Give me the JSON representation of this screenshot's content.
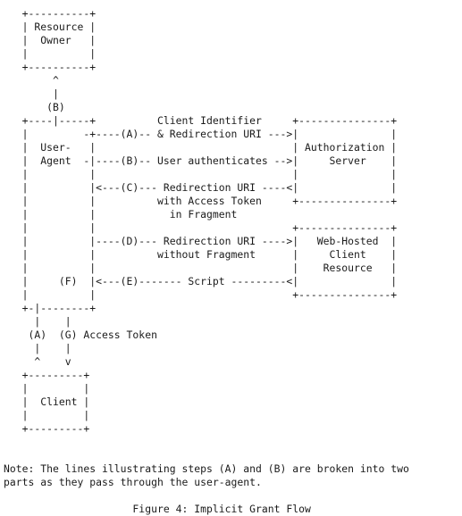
{
  "figure": {
    "lines": [
      "   +----------+",
      "   | Resource |",
      "   |  Owner   |",
      "   |          |",
      "   +----------+",
      "        ^",
      "        |",
      "       (B)",
      "   +----|-----+          Client Identifier     +---------------+",
      "   |         -+----(A)-- & Redirection URI --->|               |",
      "   |  User-   |                                | Authorization |",
      "   |  Agent  -|----(B)-- User authenticates -->|     Server    |",
      "   |          |                                |               |",
      "   |          |<---(C)--- Redirection URI ----<|               |",
      "   |          |          with Access Token     +---------------+",
      "   |          |            in Fragment",
      "   |          |                                +---------------+",
      "   |          |----(D)--- Redirection URI ---->|   Web-Hosted  |",
      "   |          |          without Fragment      |     Client    |",
      "   |          |                                |    Resource   |",
      "   |     (F)  |<---(E)------- Script ---------<|               |",
      "   |          |                                +---------------+",
      "   +-|--------+",
      "     |    |",
      "    (A)  (G) Access Token",
      "     |    |",
      "     ^    v",
      "   +---------+",
      "   |         |",
      "   |  Client |",
      "   |         |",
      "   +---------+",
      "",
      "",
      "Note: The lines illustrating steps (A) and (B) are broken into two",
      "parts as they pass through the user-agent.",
      "",
      "                     Figure 4: Implicit Grant Flow"
    ],
    "entities": {
      "resource_owner": "Resource Owner",
      "user_agent": "User-Agent",
      "authorization_server": "Authorization Server",
      "web_hosted_client_resource": "Web-Hosted Client Resource",
      "client": "Client"
    },
    "steps": {
      "A": "Client Identifier & Redirection URI",
      "B": "User authenticates",
      "C": "Redirection URI with Access Token in Fragment",
      "D": "Redirection URI without Fragment",
      "E": "Script",
      "F": "",
      "G": "Access Token"
    },
    "note": "Note: The lines illustrating steps (A) and (B) are broken into two parts as they pass through the user-agent.",
    "caption": "Figure 4: Implicit Grant Flow",
    "colors": {
      "left_bar": "#5b0f4a",
      "right_bar": "#4b9fd0",
      "text": "#1a1a1a"
    }
  }
}
